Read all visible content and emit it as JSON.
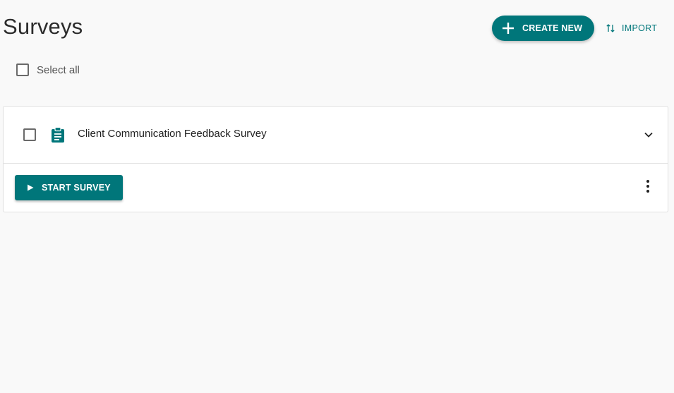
{
  "header": {
    "title": "Surveys",
    "create_label": "CREATE NEW",
    "import_label": "IMPORT"
  },
  "selection": {
    "select_all_label": "Select all",
    "checked": false
  },
  "surveys": [
    {
      "title": "Client Communication Feedback Survey",
      "start_label": "START SURVEY",
      "checked": false
    }
  ],
  "icons": {
    "create": "plus-icon",
    "import": "swap-vertical-icon",
    "survey": "clipboard-icon",
    "expand": "chevron-down-icon",
    "start": "play-icon",
    "more": "more-vertical-icon"
  },
  "colors": {
    "accent": "#00767a",
    "background": "#f9f9f9"
  }
}
